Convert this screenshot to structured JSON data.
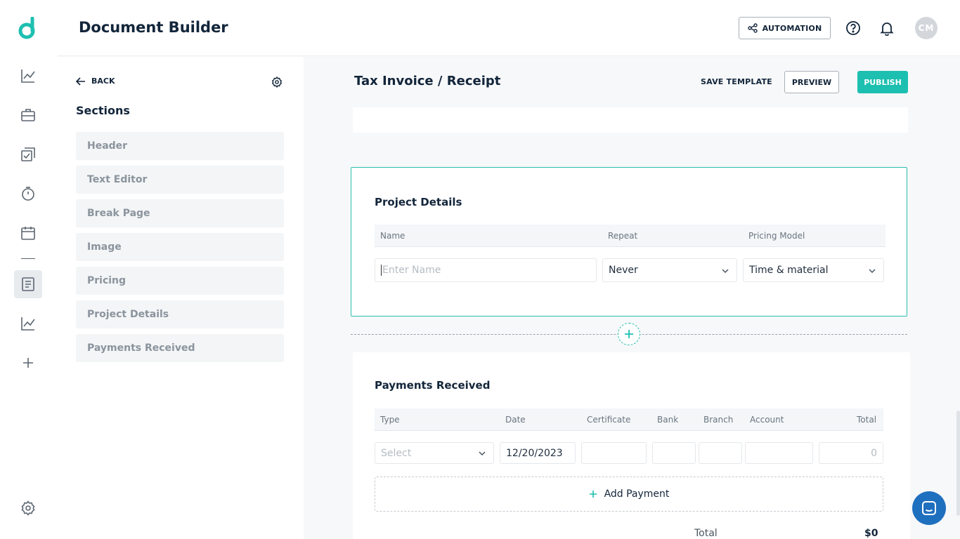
{
  "app": {
    "title": "Document Builder"
  },
  "header": {
    "automation_label": "AUTOMATION",
    "avatar_initials": "CM"
  },
  "sidebar": {
    "back_label": "BACK",
    "title": "Sections",
    "items": [
      {
        "label": "Header"
      },
      {
        "label": "Text Editor"
      },
      {
        "label": "Break Page"
      },
      {
        "label": "Image"
      },
      {
        "label": "Pricing"
      },
      {
        "label": "Project Details"
      },
      {
        "label": "Payments Received"
      }
    ]
  },
  "document": {
    "title": "Tax Invoice / Receipt",
    "save_template_label": "SAVE TEMPLATE",
    "preview_label": "PREVIEW",
    "publish_label": "PUBLISH"
  },
  "project_details": {
    "title": "Project Details",
    "columns": [
      "Name",
      "Repeat",
      "Pricing Model"
    ],
    "name_placeholder": "Enter Name",
    "repeat_value": "Never",
    "pricing_model_value": "Time & material"
  },
  "payments": {
    "title": "Payments Received",
    "columns": [
      "Type",
      "Date",
      "Certificate",
      "Bank",
      "Branch",
      "Account",
      "Total"
    ],
    "type_placeholder": "Select",
    "date_value": "12/20/2023",
    "total_placeholder": "0",
    "add_label": "Add Payment",
    "total_label": "Total",
    "total_value": "$0"
  },
  "colors": {
    "accent": "#1dbfb0",
    "chat": "#1f6fbf"
  }
}
